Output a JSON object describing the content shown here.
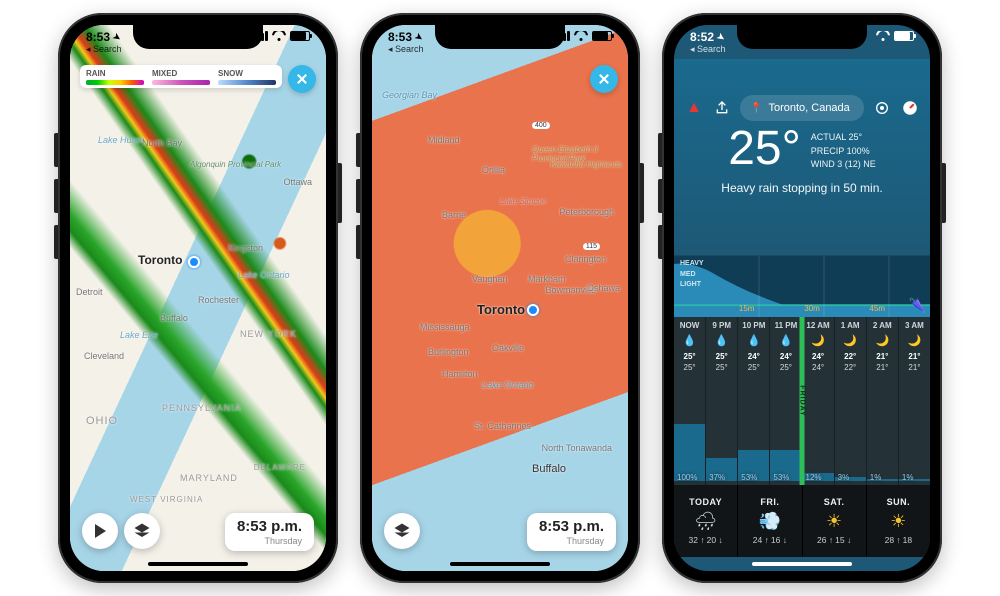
{
  "status": {
    "time1": "8:53",
    "time2": "8:53",
    "time3": "8:52",
    "back": "Search"
  },
  "legend": {
    "rain": "RAIN",
    "mixed": "MIXED",
    "snow": "SNOW"
  },
  "mapTime": {
    "time": "8:53 p.m.",
    "day": "Thursday"
  },
  "map1": {
    "labels": {
      "toronto": "Toronto",
      "ottawa": "Ottawa",
      "kingston": "Kingston",
      "buffalo": "Buffalo",
      "cleveland": "Cleveland",
      "detroit": "Detroit",
      "rochester": "Rochester",
      "northbay": "North Bay",
      "lakeHuron": "Lake Huron",
      "lakeOntario": "Lake Ontario",
      "lakeErie": "Lake Erie",
      "ohio": "OHIO",
      "penn": "PENNSYLVANIA",
      "ny": "NEW YORK",
      "maryland": "MARYLAND",
      "delaware": "DELAWARE",
      "algonquin": "Algonquin Provincial Park",
      "westvirginia": "WEST VIRGINIA"
    }
  },
  "map2": {
    "labels": {
      "toronto": "Toronto",
      "mississauga": "Mississauga",
      "burlington": "Burlington",
      "hamilton": "Hamilton",
      "oakville": "Oakville",
      "vaughan": "Vaughan",
      "markham": "Markham",
      "barrie": "Barrie",
      "oshawa": "Oshawa",
      "peterborough": "Peterborough",
      "buffalo": "Buffalo",
      "stcath": "St. Catharines",
      "northton": "North Tonawanda",
      "lakeOntario": "Lake Ontario",
      "georgian": "Georgian Bay",
      "simcoe": "Lake Simcoe",
      "midland": "Midland",
      "orillia": "Orillia",
      "bowman": "Bowmanville",
      "clarington": "Clarington",
      "hwy400": "400",
      "hwy115": "115",
      "qe": "Queen Elizabeth II Provincial Park",
      "kawartha": "Kawartha Highlands"
    }
  },
  "wx": {
    "location": "Toronto, Canada",
    "temp": "25°",
    "stats": {
      "actual": "ACTUAL 25°",
      "precip": "PRECIP 100%",
      "wind": "WIND 3 (12) NE"
    },
    "summary": "Heavy rain stopping in 50 min.",
    "precipY": {
      "heavy": "HEAVY",
      "med": "MED",
      "light": "LIGHT"
    },
    "precipX": {
      "a": "15m",
      "b": "30m",
      "c": "45m"
    },
    "hourly": [
      {
        "t": "NOW",
        "hi": "25°",
        "lo": "25°",
        "pct": "100%",
        "bar": 95,
        "ico": "drop"
      },
      {
        "t": "9 PM",
        "hi": "25°",
        "lo": "25°",
        "pct": "37%",
        "bar": 38,
        "ico": "drop"
      },
      {
        "t": "10 PM",
        "hi": "24°",
        "lo": "25°",
        "pct": "53%",
        "bar": 52,
        "ico": "drop"
      },
      {
        "t": "11 PM",
        "hi": "24°",
        "lo": "25°",
        "pct": "53%",
        "bar": 52,
        "ico": "drop"
      },
      {
        "t": "12 AM",
        "hi": "24°",
        "lo": "24°",
        "pct": "12%",
        "bar": 14,
        "ico": "moon"
      },
      {
        "t": "1 AM",
        "hi": "22°",
        "lo": "22°",
        "pct": "3%",
        "bar": 6,
        "ico": "moon"
      },
      {
        "t": "2 AM",
        "hi": "21°",
        "lo": "21°",
        "pct": "1%",
        "bar": 4,
        "ico": "moon"
      },
      {
        "t": "3 AM",
        "hi": "21°",
        "lo": "21°",
        "pct": "1%",
        "bar": 4,
        "ico": "moon"
      }
    ],
    "friday": "FRIDAY",
    "daily": [
      {
        "day": "TODAY",
        "ico": "rainy",
        "hi": "32 ↑",
        "lo": "20 ↓"
      },
      {
        "day": "FRI.",
        "ico": "windy",
        "hi": "24 ↑",
        "lo": "16 ↓"
      },
      {
        "day": "SAT.",
        "ico": "sunny",
        "hi": "26 ↑",
        "lo": "15 ↓"
      },
      {
        "day": "SUN.",
        "ico": "sunny",
        "hi": "28 ↑",
        "lo": "18"
      }
    ]
  }
}
